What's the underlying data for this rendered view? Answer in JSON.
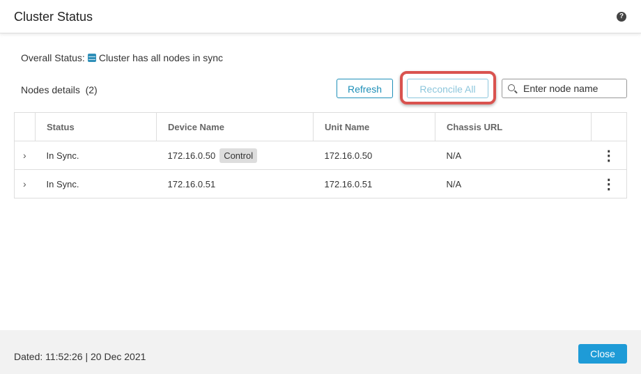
{
  "header": {
    "title": "Cluster Status",
    "help_icon": "?"
  },
  "overall": {
    "label": "Overall Status:",
    "icon": "database-icon",
    "text": "Cluster has all nodes in sync"
  },
  "nodes": {
    "label": "Nodes details",
    "count": "(2)"
  },
  "toolbar": {
    "refresh": "Refresh",
    "reconcile": "Reconcile All",
    "search_placeholder": "Enter node name"
  },
  "table": {
    "columns": [
      "Status",
      "Device Name",
      "Unit Name",
      "Chassis URL"
    ],
    "rows": [
      {
        "status": "In Sync.",
        "device": "172.16.0.50",
        "tag": "Control",
        "unit": "172.16.0.50",
        "chassis": "N/A"
      },
      {
        "status": "In Sync.",
        "device": "172.16.0.51",
        "unit": "172.16.0.51",
        "chassis": "N/A"
      }
    ]
  },
  "footer": {
    "dated": "Dated: 11:52:26 | 20 Dec 2021",
    "close": "Close"
  },
  "colors": {
    "accent": "#1e9bd7",
    "highlight": "#d9534f"
  }
}
